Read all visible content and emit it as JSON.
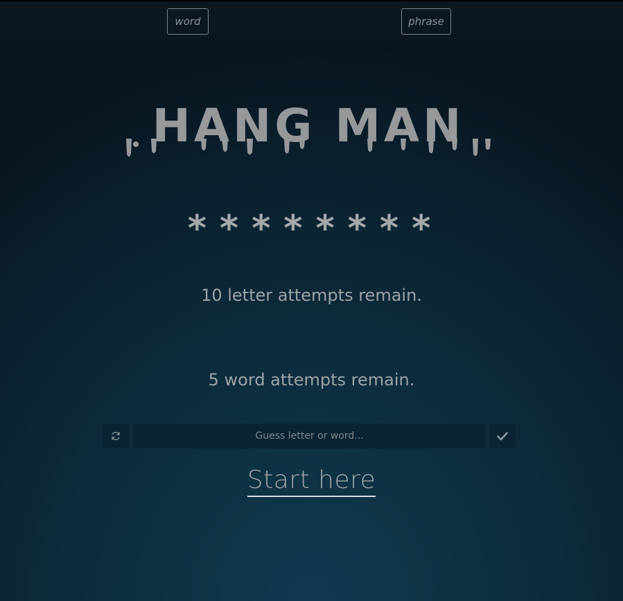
{
  "modes": {
    "word_label": "word",
    "phrase_label": "phrase"
  },
  "title": "HANG MAN",
  "masked_answer": "********",
  "status": {
    "letters": "10 letter attempts remain.",
    "words": "5 word attempts remain."
  },
  "guess": {
    "placeholder": "Guess letter or word...",
    "value": ""
  },
  "icons": {
    "reset": "refresh-icon",
    "submit": "check-icon"
  },
  "start_link": "Start here",
  "colors": {
    "background": "#0c2c3d",
    "text": "#a5a8aa",
    "accent_underline": "#d9dde0"
  }
}
